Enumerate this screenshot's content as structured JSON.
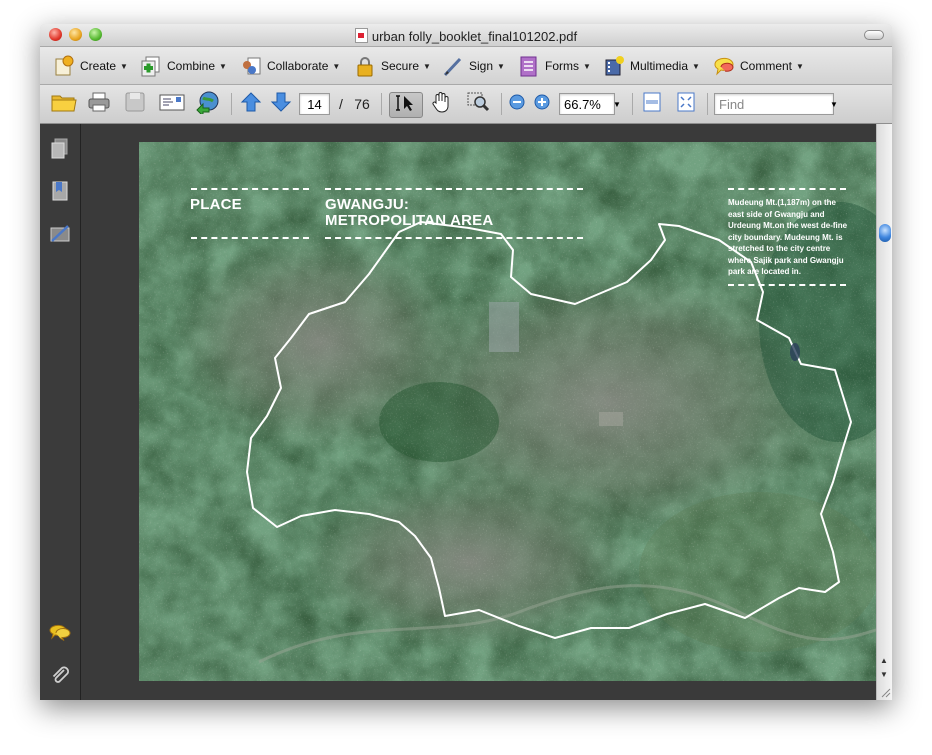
{
  "window": {
    "title": "urban folly_booklet_final101202.pdf"
  },
  "tasks": [
    {
      "label": "Create",
      "icon": "create-icon"
    },
    {
      "label": "Combine",
      "icon": "combine-icon"
    },
    {
      "label": "Collaborate",
      "icon": "collaborate-icon"
    },
    {
      "label": "Secure",
      "icon": "lock-icon"
    },
    {
      "label": "Sign",
      "icon": "pen-icon"
    },
    {
      "label": "Forms",
      "icon": "forms-icon"
    },
    {
      "label": "Multimedia",
      "icon": "multimedia-icon"
    },
    {
      "label": "Comment",
      "icon": "comment-bubble-icon"
    }
  ],
  "toolbar": {
    "page_current": "14",
    "page_separator": "/",
    "page_total": "76",
    "zoom": "66.7%",
    "find_placeholder": "Find"
  },
  "document": {
    "place_label": "PLACE",
    "title_line1": "GWANGJU:",
    "title_line2": "METROPOLITAN AREA",
    "description": "Mudeung Mt.(1,187m) on the east side of Gwangju and Urdeung Mt.on the west de-fine city boundary. Mudeung Mt. is stretched to the city centre where Sajik park and Gwangju park are located in."
  }
}
